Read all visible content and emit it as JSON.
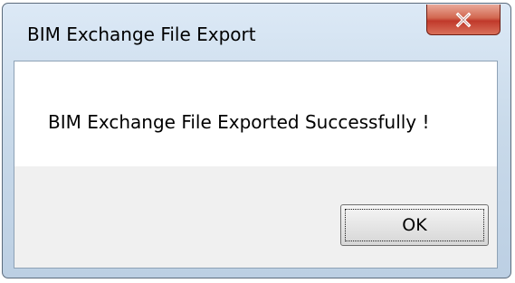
{
  "window": {
    "title": "BIM Exchange File Export",
    "close_icon": "close-icon"
  },
  "dialog": {
    "message": "BIM Exchange File Exported Successfully !",
    "ok_label": "OK"
  },
  "colors": {
    "close_button": "#c0392b",
    "titlebar": "#c9daea",
    "client_background": "#f0f0f0",
    "message_background": "#ffffff"
  }
}
